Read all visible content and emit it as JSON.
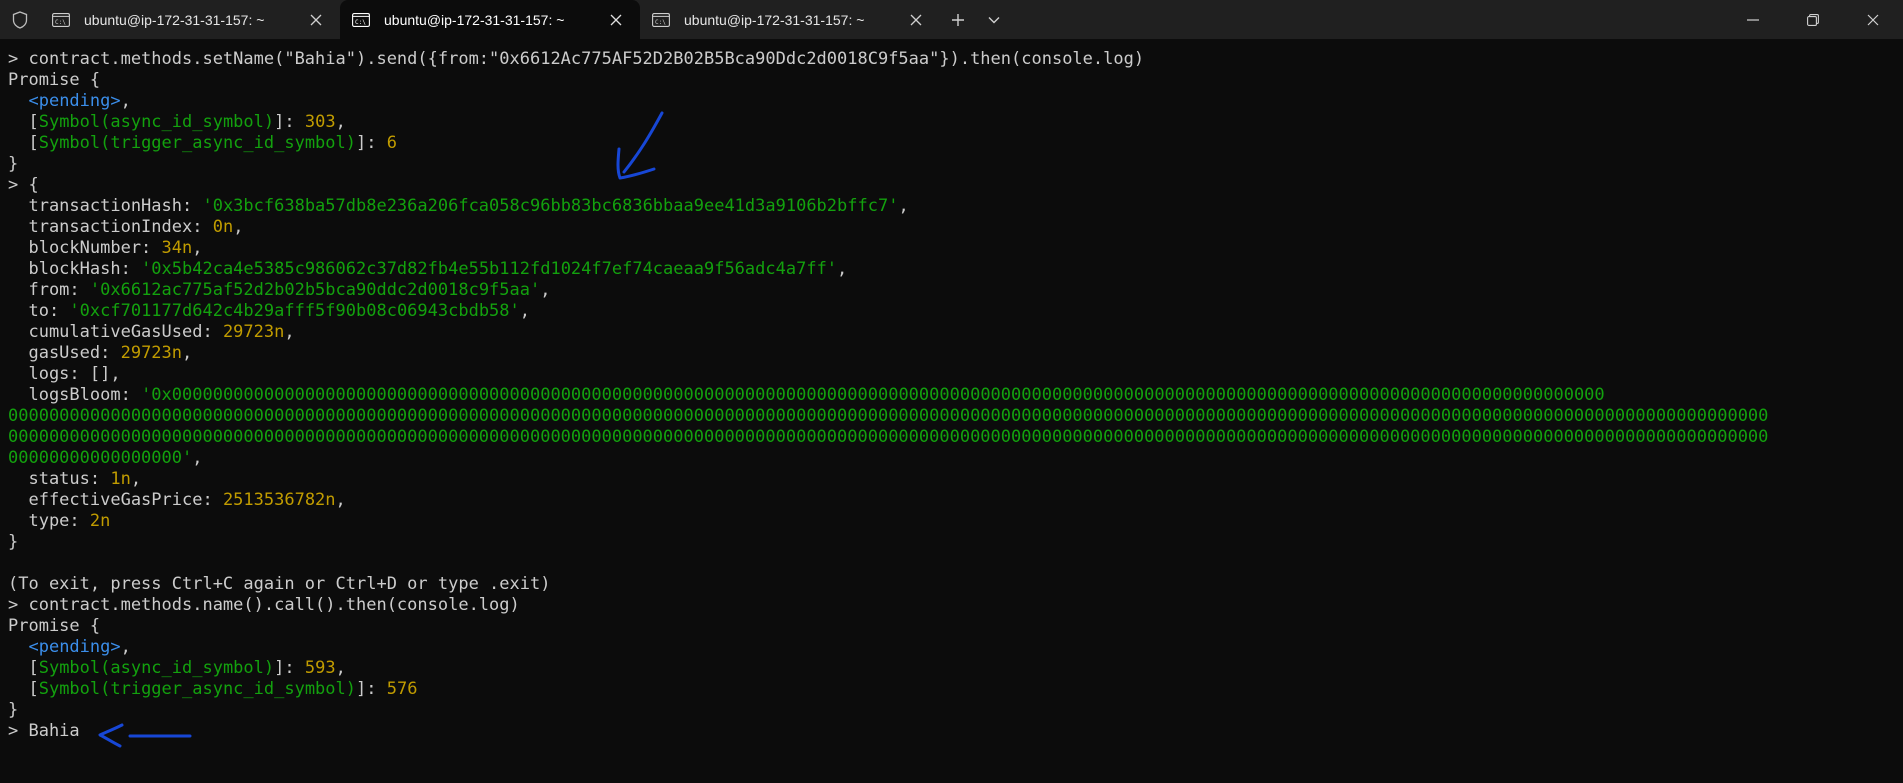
{
  "window": {
    "tabs": [
      {
        "title": "ubuntu@ip-172-31-31-157: ~",
        "active": false
      },
      {
        "title": "ubuntu@ip-172-31-31-157: ~",
        "active": true
      },
      {
        "title": "ubuntu@ip-172-31-31-157: ~",
        "active": false
      }
    ]
  },
  "terminal": {
    "cmd1": "> contract.methods.setName(\"Bahia\").send({from:\"0x6612Ac775AF52D2B02B5Bca90Ddc2d0018C9f5aa\"}).then(console.log)",
    "promise_open": "Promise {",
    "pending": "<pending>",
    "comma": ",",
    "sym_async": "Symbol(async_id_symbol)",
    "sym_trigger": "Symbol(trigger_async_id_symbol)",
    "p1_async_id": "303",
    "p1_trigger_id": "6",
    "close_brace": "}",
    "receipt_open": "> {",
    "receipt": {
      "transactionHash": "'0x3bcf638ba57db8e236a206fca058c96bb83bc6836bbaa9ee41d3a9106b2bffc7'",
      "transactionIndex": "0n",
      "blockNumber": "34n",
      "blockHash": "'0x5b42ca4e5385c986062c37d82fb4e55b112fd1024f7ef74caeaa9f56adc4a7ff'",
      "from": "'0x6612ac775af52d2b02b5bca90ddc2d0018c9f5aa'",
      "to": "'0xcf701177d642c4b29afff5f90b08c06943cbdb58'",
      "cumulativeGasUsed": "29723n",
      "gasUsed": "29723n",
      "logs": "[]",
      "logsBloom_1": "'0x00000000000000000000000000000000000000000000000000000000000000000000000000000000000000000000000000000000000000000000000000000000000000000000",
      "logsBloom_2": "0000000000000000000000000000000000000000000000000000000000000000000000000000000000000000000000000000000000000000000000000000000000000000000000000000000000000000000000000000",
      "logsBloom_3": "0000000000000000000000000000000000000000000000000000000000000000000000000000000000000000000000000000000000000000000000000000000000000000000000000000000000000000000000000000",
      "logsBloom_4": "00000000000000000'",
      "status": "1n",
      "effectiveGasPrice": "2513536782n",
      "type": "2n"
    },
    "exit_hint": "(To exit, press Ctrl+C again or Ctrl+D or type .exit)",
    "cmd2": "> contract.methods.name().call().then(console.log)",
    "p2_async_id": "593",
    "p2_trigger_id": "576",
    "result": "> Bahia"
  },
  "colors": {
    "background": "#0c0c0c",
    "text": "#cccccc",
    "string": "#13a10e",
    "number": "#c19c00",
    "special": "#3b8eea",
    "annotation": "#1747d6"
  }
}
